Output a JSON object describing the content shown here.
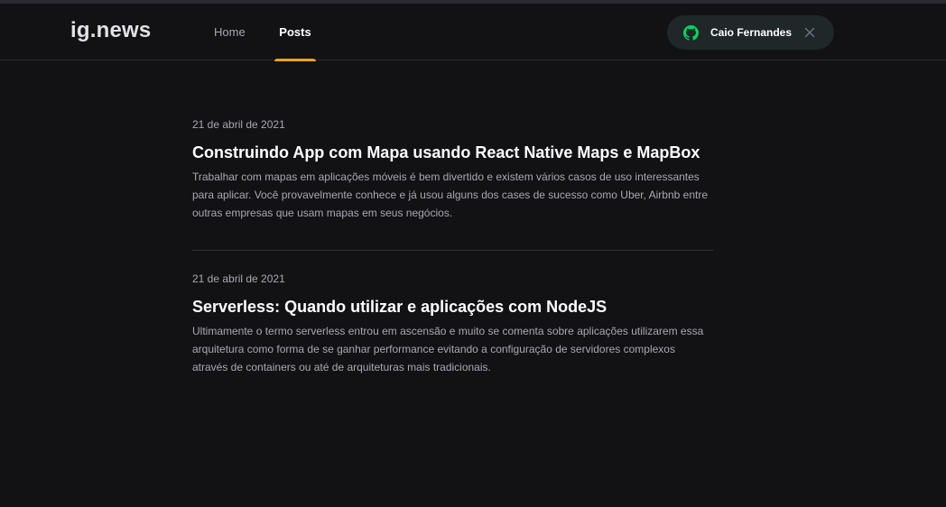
{
  "header": {
    "logo": "ig.news",
    "nav": [
      {
        "label": "Home",
        "active": false
      },
      {
        "label": "Posts",
        "active": true
      }
    ],
    "user": {
      "name": "Caio Fernandes",
      "icon": "github-icon",
      "icon_color": "#04d361"
    }
  },
  "colors": {
    "background": "#121214",
    "accent": "#eba417",
    "button_bg": "#1f2729"
  },
  "posts": [
    {
      "date": "21 de abril de 2021",
      "title": "Construindo App com Mapa usando React Native Maps e MapBox",
      "excerpt": "Trabalhar com mapas em aplicações móveis é bem divertido e existem vários casos de uso interessantes para aplicar. Você provavelmente conhece e já usou alguns dos cases de sucesso como Uber, Airbnb entre outras empresas que usam mapas em seus negócios."
    },
    {
      "date": "21 de abril de 2021",
      "title": "Serverless: Quando utilizar e aplicações com NodeJS",
      "excerpt": "Ultimamente o termo serverless entrou em ascensão e muito se comenta sobre aplicações utilizarem essa arquitetura como forma de se ganhar performance evitando a configuração de servidores complexos através de containers ou até de arquiteturas mais tradicionais."
    }
  ]
}
